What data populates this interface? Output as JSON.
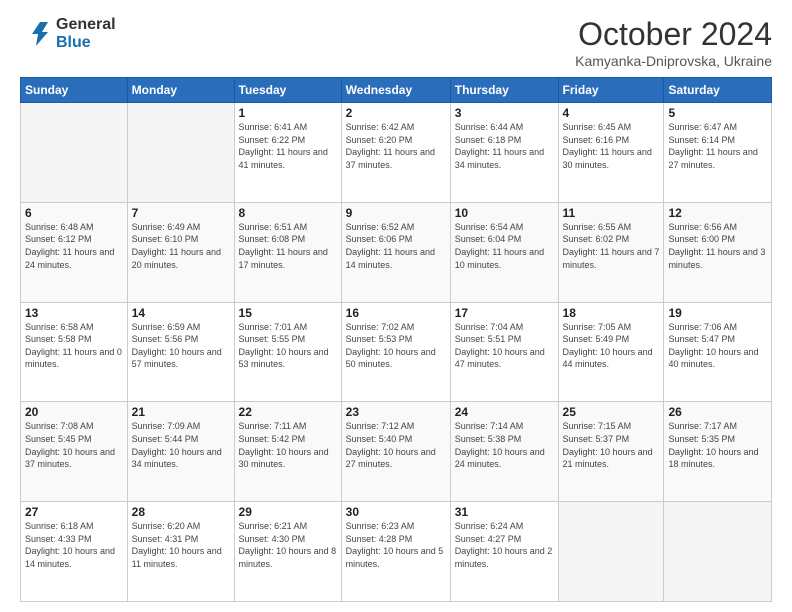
{
  "logo": {
    "general": "General",
    "blue": "Blue"
  },
  "header": {
    "title": "October 2024",
    "subtitle": "Kamyanka-Dniprovska, Ukraine"
  },
  "weekdays": [
    "Sunday",
    "Monday",
    "Tuesday",
    "Wednesday",
    "Thursday",
    "Friday",
    "Saturday"
  ],
  "weeks": [
    [
      {
        "day": "",
        "info": ""
      },
      {
        "day": "",
        "info": ""
      },
      {
        "day": "1",
        "info": "Sunrise: 6:41 AM\nSunset: 6:22 PM\nDaylight: 11 hours and 41 minutes."
      },
      {
        "day": "2",
        "info": "Sunrise: 6:42 AM\nSunset: 6:20 PM\nDaylight: 11 hours and 37 minutes."
      },
      {
        "day": "3",
        "info": "Sunrise: 6:44 AM\nSunset: 6:18 PM\nDaylight: 11 hours and 34 minutes."
      },
      {
        "day": "4",
        "info": "Sunrise: 6:45 AM\nSunset: 6:16 PM\nDaylight: 11 hours and 30 minutes."
      },
      {
        "day": "5",
        "info": "Sunrise: 6:47 AM\nSunset: 6:14 PM\nDaylight: 11 hours and 27 minutes."
      }
    ],
    [
      {
        "day": "6",
        "info": "Sunrise: 6:48 AM\nSunset: 6:12 PM\nDaylight: 11 hours and 24 minutes."
      },
      {
        "day": "7",
        "info": "Sunrise: 6:49 AM\nSunset: 6:10 PM\nDaylight: 11 hours and 20 minutes."
      },
      {
        "day": "8",
        "info": "Sunrise: 6:51 AM\nSunset: 6:08 PM\nDaylight: 11 hours and 17 minutes."
      },
      {
        "day": "9",
        "info": "Sunrise: 6:52 AM\nSunset: 6:06 PM\nDaylight: 11 hours and 14 minutes."
      },
      {
        "day": "10",
        "info": "Sunrise: 6:54 AM\nSunset: 6:04 PM\nDaylight: 11 hours and 10 minutes."
      },
      {
        "day": "11",
        "info": "Sunrise: 6:55 AM\nSunset: 6:02 PM\nDaylight: 11 hours and 7 minutes."
      },
      {
        "day": "12",
        "info": "Sunrise: 6:56 AM\nSunset: 6:00 PM\nDaylight: 11 hours and 3 minutes."
      }
    ],
    [
      {
        "day": "13",
        "info": "Sunrise: 6:58 AM\nSunset: 5:58 PM\nDaylight: 11 hours and 0 minutes."
      },
      {
        "day": "14",
        "info": "Sunrise: 6:59 AM\nSunset: 5:56 PM\nDaylight: 10 hours and 57 minutes."
      },
      {
        "day": "15",
        "info": "Sunrise: 7:01 AM\nSunset: 5:55 PM\nDaylight: 10 hours and 53 minutes."
      },
      {
        "day": "16",
        "info": "Sunrise: 7:02 AM\nSunset: 5:53 PM\nDaylight: 10 hours and 50 minutes."
      },
      {
        "day": "17",
        "info": "Sunrise: 7:04 AM\nSunset: 5:51 PM\nDaylight: 10 hours and 47 minutes."
      },
      {
        "day": "18",
        "info": "Sunrise: 7:05 AM\nSunset: 5:49 PM\nDaylight: 10 hours and 44 minutes."
      },
      {
        "day": "19",
        "info": "Sunrise: 7:06 AM\nSunset: 5:47 PM\nDaylight: 10 hours and 40 minutes."
      }
    ],
    [
      {
        "day": "20",
        "info": "Sunrise: 7:08 AM\nSunset: 5:45 PM\nDaylight: 10 hours and 37 minutes."
      },
      {
        "day": "21",
        "info": "Sunrise: 7:09 AM\nSunset: 5:44 PM\nDaylight: 10 hours and 34 minutes."
      },
      {
        "day": "22",
        "info": "Sunrise: 7:11 AM\nSunset: 5:42 PM\nDaylight: 10 hours and 30 minutes."
      },
      {
        "day": "23",
        "info": "Sunrise: 7:12 AM\nSunset: 5:40 PM\nDaylight: 10 hours and 27 minutes."
      },
      {
        "day": "24",
        "info": "Sunrise: 7:14 AM\nSunset: 5:38 PM\nDaylight: 10 hours and 24 minutes."
      },
      {
        "day": "25",
        "info": "Sunrise: 7:15 AM\nSunset: 5:37 PM\nDaylight: 10 hours and 21 minutes."
      },
      {
        "day": "26",
        "info": "Sunrise: 7:17 AM\nSunset: 5:35 PM\nDaylight: 10 hours and 18 minutes."
      }
    ],
    [
      {
        "day": "27",
        "info": "Sunrise: 6:18 AM\nSunset: 4:33 PM\nDaylight: 10 hours and 14 minutes."
      },
      {
        "day": "28",
        "info": "Sunrise: 6:20 AM\nSunset: 4:31 PM\nDaylight: 10 hours and 11 minutes."
      },
      {
        "day": "29",
        "info": "Sunrise: 6:21 AM\nSunset: 4:30 PM\nDaylight: 10 hours and 8 minutes."
      },
      {
        "day": "30",
        "info": "Sunrise: 6:23 AM\nSunset: 4:28 PM\nDaylight: 10 hours and 5 minutes."
      },
      {
        "day": "31",
        "info": "Sunrise: 6:24 AM\nSunset: 4:27 PM\nDaylight: 10 hours and 2 minutes."
      },
      {
        "day": "",
        "info": ""
      },
      {
        "day": "",
        "info": ""
      }
    ]
  ]
}
